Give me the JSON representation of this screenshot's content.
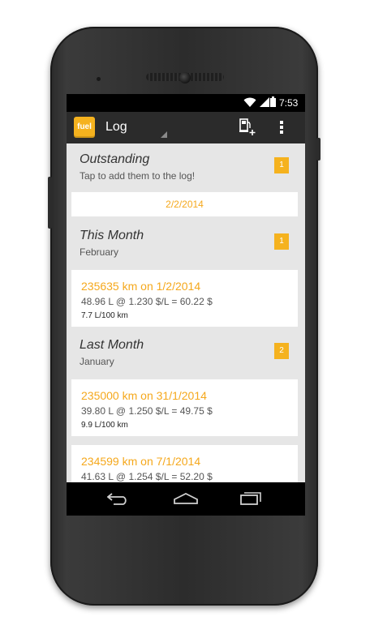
{
  "status_bar": {
    "time": "7:53"
  },
  "action_bar": {
    "app_icon_text": "fuel",
    "title": "Log",
    "icons": {
      "add_fuel": "fuel-pump-plus-icon",
      "overflow": "overflow-menu-icon"
    }
  },
  "outstanding": {
    "title": "Outstanding",
    "subtitle": "Tap to add them to the log!",
    "badge": "1",
    "date": "2/2/2014"
  },
  "this_month": {
    "title": "This Month",
    "subtitle": "February",
    "badge": "1",
    "entries": [
      {
        "title": "235635 km on 1/2/2014",
        "calc": "48.96 L @ 1.230 $/L = 60.22 $",
        "efficiency": "7.7 L/100 km"
      }
    ]
  },
  "last_month": {
    "title": "Last Month",
    "subtitle": "January",
    "badge": "2",
    "entries": [
      {
        "title": "235000 km on 31/1/2014",
        "calc": "39.80 L @ 1.250 $/L = 49.75 $",
        "efficiency": "9.9 L/100 km"
      },
      {
        "title": "234599 km on 7/1/2014",
        "calc": "41.63 L @ 1.254 $/L = 52.20 $"
      }
    ]
  },
  "colors": {
    "accent": "#f5b21e",
    "accent_text": "#f5a81c",
    "action_bar": "#2b2b2b",
    "list_bg": "#e6e6e6"
  }
}
